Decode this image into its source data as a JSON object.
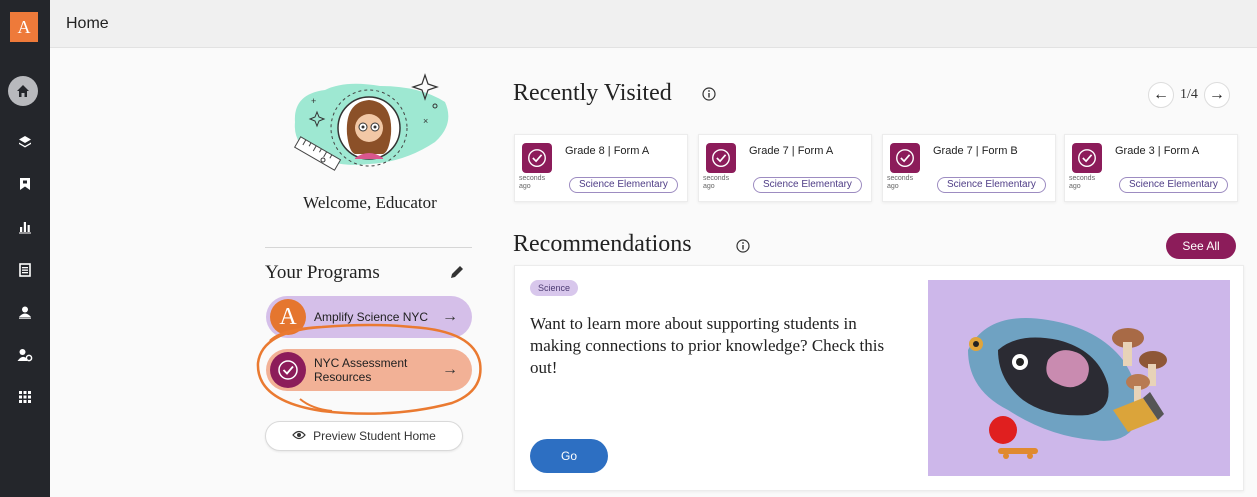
{
  "app": {
    "logo_letter": "A",
    "page_title": "Home"
  },
  "sidebar": {
    "items": [
      {
        "icon": "home-icon",
        "active": true
      },
      {
        "icon": "layers-icon"
      },
      {
        "icon": "bookmark-icon"
      },
      {
        "icon": "bar-chart-icon"
      },
      {
        "icon": "document-icon"
      },
      {
        "icon": "student-icon"
      },
      {
        "icon": "user-settings-icon"
      },
      {
        "icon": "apps-grid-icon"
      }
    ]
  },
  "profile": {
    "welcome": "Welcome, Educator"
  },
  "programs": {
    "title": "Your Programs",
    "items": [
      {
        "icon_letter": "A",
        "label": "Amplify Science NYC",
        "arrow": "→"
      },
      {
        "label_line1": "NYC Assessment",
        "label_line2": "Resources",
        "arrow": "→"
      }
    ],
    "preview_button": "Preview Student Home"
  },
  "recently_visited": {
    "title": "Recently Visited",
    "pager": {
      "text": "1/4"
    },
    "cards": [
      {
        "title": "Grade 8 | Form A",
        "ago_line1": "seconds",
        "ago_line2": "ago",
        "pill": "Science Elementary"
      },
      {
        "title": "Grade 7 | Form A",
        "ago_line1": "seconds",
        "ago_line2": "ago",
        "pill": "Science Elementary"
      },
      {
        "title": "Grade 7 | Form B",
        "ago_line1": "seconds",
        "ago_line2": "ago",
        "pill": "Science Elementary"
      },
      {
        "title": "Grade 3 | Form A",
        "ago_line1": "seconds",
        "ago_line2": "ago",
        "pill": "Science Elementary"
      }
    ]
  },
  "recommendations": {
    "title": "Recommendations",
    "see_all": "See All",
    "card": {
      "tag": "Science",
      "text": "Want to learn more about supporting students in making connections to prior knowledge? Check this out!",
      "button": "Go"
    }
  },
  "colors": {
    "accent_orange": "#ee7a3a",
    "brand_magenta": "#8c1c5a",
    "go_blue": "#2d6fc2",
    "lavender": "#d5bfe9",
    "peach": "#f2b196"
  }
}
